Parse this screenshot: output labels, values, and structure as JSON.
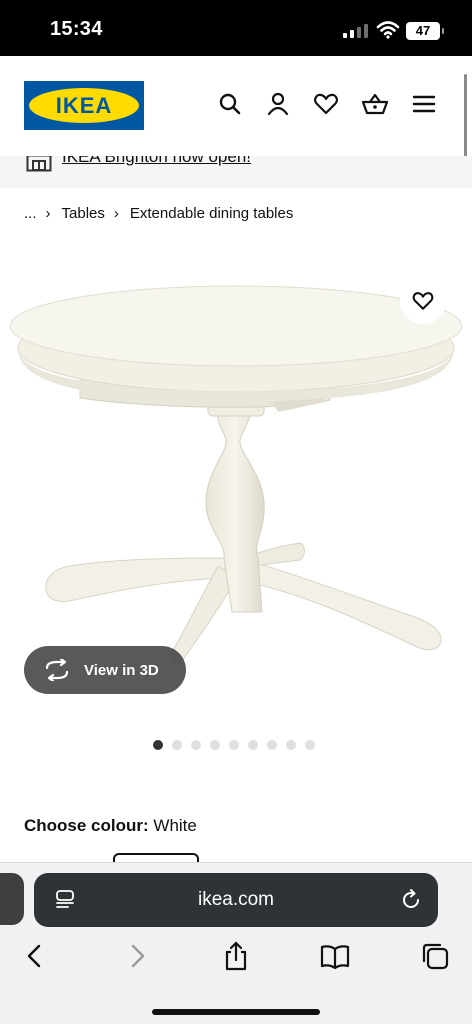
{
  "status_bar": {
    "time": "15:34",
    "battery": "47"
  },
  "header": {
    "logo_text": "IKEA",
    "icons": [
      "search-icon",
      "account-icon",
      "favourites-icon",
      "basket-icon",
      "menu-icon"
    ]
  },
  "banner": {
    "text": "IKEA Brighton now open!"
  },
  "breadcrumb": {
    "ellipsis": "...",
    "items": [
      "Tables",
      "Extendable dining tables"
    ]
  },
  "product": {
    "view_3d_label": "View in 3D",
    "carousel": {
      "total": 9,
      "active": 1
    }
  },
  "colour": {
    "label": "Choose colour:",
    "value": "White"
  },
  "browser": {
    "url": "ikea.com",
    "toolbar_icons": [
      "back-icon",
      "forward-icon",
      "share-icon",
      "bookmarks-icon",
      "tabs-icon"
    ]
  },
  "colors": {
    "ikea_blue": "#0058a3",
    "ikea_yellow": "#ffdb00",
    "urlbar": "#2e3336"
  }
}
